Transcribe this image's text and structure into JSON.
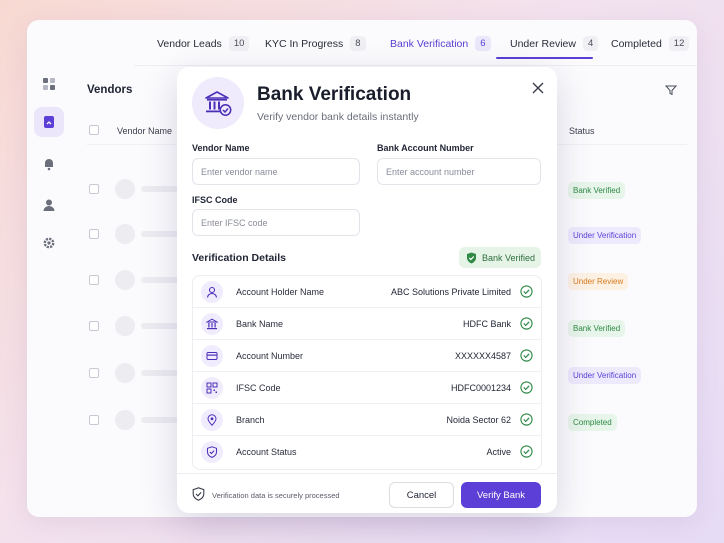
{
  "tabs": [
    {
      "label": "Vendor Leads",
      "count": "10"
    },
    {
      "label": "KYC In Progress",
      "count": "8"
    },
    {
      "label": "Bank Verification",
      "count": "6"
    },
    {
      "label": "Under Review",
      "count": "4"
    },
    {
      "label": "Completed",
      "count": "12"
    }
  ],
  "active_tab": "Bank Verification",
  "sidebar": {
    "items": [
      {
        "icon": "dashboard-icon"
      },
      {
        "icon": "document-icon",
        "active": true
      },
      {
        "icon": "bell-icon"
      },
      {
        "icon": "user-icon"
      },
      {
        "icon": "gear-icon"
      }
    ]
  },
  "vendors_panel": {
    "title": "Vendors",
    "columns": {
      "vendor_name": "Vendor Name",
      "status": "Status"
    },
    "statuses": [
      {
        "label": "Bank Verified",
        "tone": "green"
      },
      {
        "label": "Under Verification",
        "tone": "purple"
      },
      {
        "label": "Under Review",
        "tone": "orange"
      },
      {
        "label": "Bank Verified",
        "tone": "green"
      },
      {
        "label": "Under Verification",
        "tone": "purple"
      },
      {
        "label": "Completed",
        "tone": "green"
      }
    ]
  },
  "modal": {
    "title": "Bank Verification",
    "subtitle": "Verify vendor bank details instantly",
    "fields": {
      "vendor_name": {
        "label": "Vendor Name",
        "placeholder": "Enter vendor name"
      },
      "account_number": {
        "label": "Bank Account Number",
        "placeholder": "Enter account number"
      },
      "ifsc": {
        "label": "IFSC Code",
        "placeholder": "Enter IFSC code"
      }
    },
    "details_title": "Verification Details",
    "verified_badge": "Bank Verified",
    "details": [
      {
        "icon": "user-icon",
        "label": "Account Holder Name",
        "value": "ABC Solutions Private Limited"
      },
      {
        "icon": "bank-icon",
        "label": "Bank Name",
        "value": "HDFC Bank"
      },
      {
        "icon": "card-icon",
        "label": "Account Number",
        "value": "XXXXXX4587"
      },
      {
        "icon": "qr-icon",
        "label": "IFSC Code",
        "value": "HDFC0001234"
      },
      {
        "icon": "location-pin-icon",
        "label": "Branch",
        "value": "Noida Sector 62"
      },
      {
        "icon": "shield-check-icon",
        "label": "Account Status",
        "value": "Active"
      }
    ],
    "footer": {
      "secure_text": "Verification data is securely processed",
      "cancel_label": "Cancel",
      "verify_label": "Verify Bank"
    }
  },
  "colors": {
    "accent": "#5b3fd6",
    "success": "#2f8a45",
    "warning": "#d37a1c"
  }
}
